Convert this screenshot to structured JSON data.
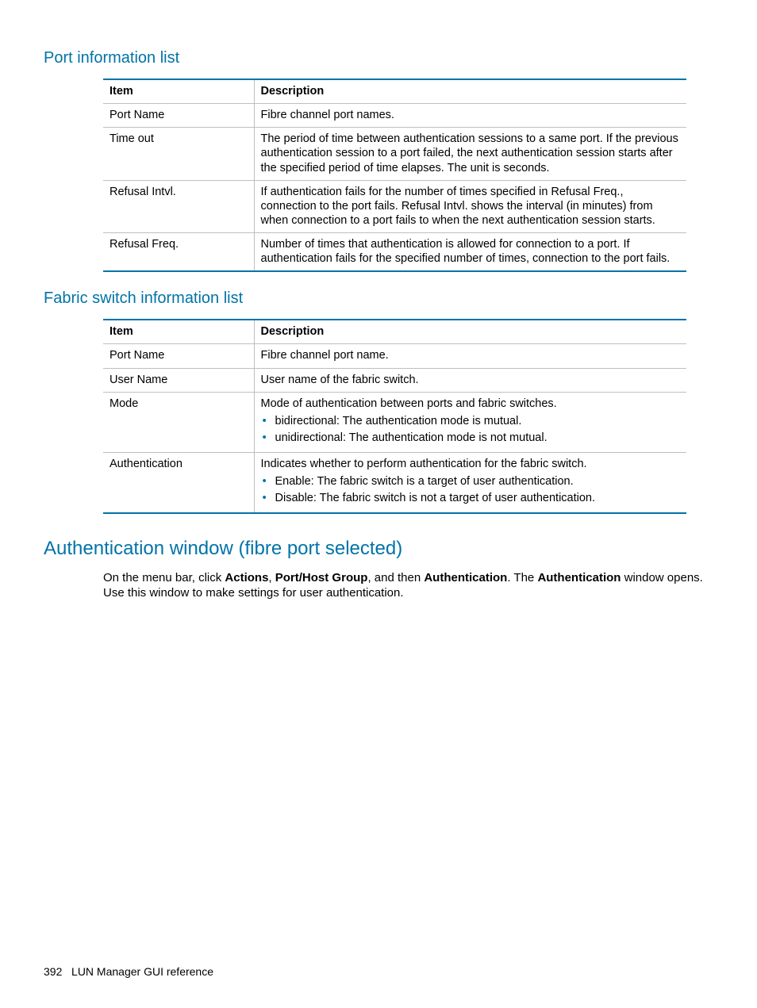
{
  "section1": {
    "title": "Port information list",
    "headers": {
      "c1": "Item",
      "c2": "Description"
    },
    "rows": [
      {
        "item": "Port Name",
        "desc": "Fibre channel port names."
      },
      {
        "item": "Time out",
        "desc": "The period of time between authentication sessions to a same port. If the previous authentication session to a port failed, the next authentication session starts after the specified period of time elapses. The unit is seconds."
      },
      {
        "item": "Refusal Intvl.",
        "desc": "If authentication fails for the number of times specified in Refusal Freq., connection to the port fails. Refusal Intvl. shows the interval (in minutes) from when connection to a port fails to when the next authentication session starts."
      },
      {
        "item": "Refusal Freq.",
        "desc": "Number of times that authentication is allowed for connection to a port. If authentication fails for the specified number of times, connection to the port fails."
      }
    ]
  },
  "section2": {
    "title": "Fabric switch information list",
    "headers": {
      "c1": "Item",
      "c2": "Description"
    },
    "rows": [
      {
        "item": "Port Name",
        "desc": "Fibre channel port name."
      },
      {
        "item": "User Name",
        "desc": "User name of the fabric switch."
      },
      {
        "item": "Mode",
        "desc_lead": "Mode of authentication between ports and fabric switches.",
        "bullets": [
          "bidirectional: The authentication mode is mutual.",
          "unidirectional: The authentication mode is not mutual."
        ]
      },
      {
        "item": "Authentication",
        "desc_lead": "Indicates whether to perform authentication for the fabric switch.",
        "bullets": [
          "Enable: The fabric switch is a target of user authentication.",
          "Disable: The fabric switch is not a target of user authentication."
        ]
      }
    ]
  },
  "section3": {
    "title": "Authentication window (fibre port selected)",
    "para": {
      "t1": "On the menu bar, click ",
      "b1": "Actions",
      "t2": ", ",
      "b2": "Port/Host Group",
      "t3": ", and then ",
      "b3": "Authentication",
      "t4": ". The ",
      "b4": "Authentication",
      "t5": " window opens. Use this window to make settings for user authentication."
    }
  },
  "footer": {
    "page": "392",
    "label": "LUN Manager GUI reference"
  }
}
